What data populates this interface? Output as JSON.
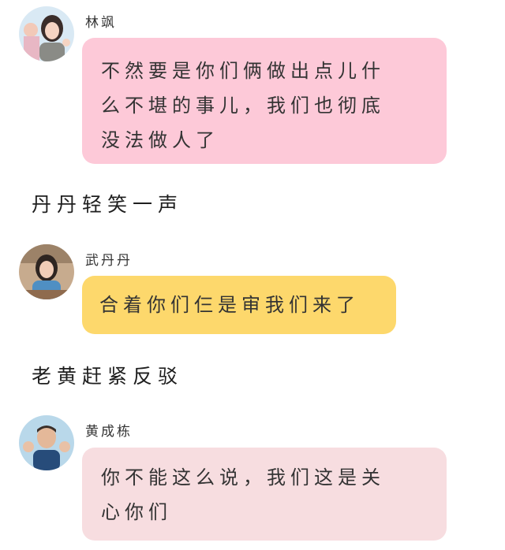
{
  "colors": {
    "pink_bubble": "#fdc9d8",
    "yellow_bubble": "#fdd86c",
    "light_pink_bubble": "#f7dde0"
  },
  "messages": [
    {
      "sender": "林飒",
      "lines": [
        "不然要是你们俩做出点儿什",
        "么不堪的事儿，我们也彻底",
        "没法做人了"
      ]
    },
    {
      "sender": "武丹丹",
      "lines": [
        "合着你们仨是审我们来了"
      ]
    },
    {
      "sender": "黄成栋",
      "lines": [
        "你不能这么说，我们这是关",
        "心你们"
      ]
    }
  ],
  "narrations": [
    "丹丹轻笑一声",
    "老黄赶紧反驳"
  ]
}
